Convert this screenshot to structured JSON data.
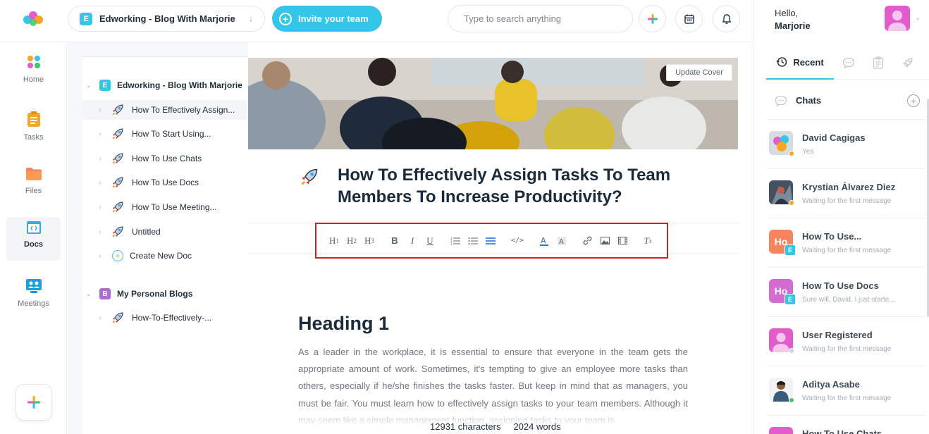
{
  "workspace": {
    "badge": "E",
    "name": "Edworking - Blog With Marjorie",
    "arrow": "↓"
  },
  "invite": {
    "label": "Invite your team"
  },
  "search": {
    "placeholder": "Type to search anything"
  },
  "rail": {
    "items": [
      {
        "label": "Home",
        "icon": "home-icon"
      },
      {
        "label": "Tasks",
        "icon": "tasks-icon"
      },
      {
        "label": "Files",
        "icon": "folder-icon"
      },
      {
        "label": "Docs",
        "icon": "docs-icon",
        "active": true
      },
      {
        "label": "Meetings",
        "icon": "meetings-icon"
      }
    ]
  },
  "tree": {
    "groups": [
      {
        "badge": "E",
        "color": "#35c5e8",
        "name": "Edworking - Blog With Marjorie"
      },
      {
        "badge": "B",
        "color": "#b06ad6",
        "name": "My Personal Blogs"
      }
    ],
    "docs": [
      {
        "label": "How To Effectively Assign..."
      },
      {
        "label": "How To Start Using..."
      },
      {
        "label": "How To Use Chats"
      },
      {
        "label": "How To Use Docs"
      },
      {
        "label": "How To Use Meeting..."
      },
      {
        "label": "Untitled"
      }
    ],
    "create_new": "Create New Doc",
    "personal_docs": [
      {
        "label": "How-To-Effectively-..."
      }
    ]
  },
  "editor": {
    "update_cover": "Update Cover",
    "title": "How To Effectively Assign Tasks To Team Members To Increase Productivity?",
    "toolbar": [
      "H1",
      "H2",
      "H3",
      "B",
      "I",
      "U",
      "ordered-list",
      "bullet-list",
      "align",
      "code",
      "text-color",
      "highlight",
      "link",
      "image",
      "video",
      "clear-format"
    ],
    "heading": "Heading 1",
    "body": "As a leader in the workplace, it is essential to ensure that everyone in the team gets the appropriate amount of work. Sometimes, it's tempting to give an employee more tasks than others, especially if he/she finishes the tasks faster. But keep in mind that as managers, you must be fair. You must learn how to effectively assign tasks to your team members. Although it may seem like a simple management function, assigning tasks to your team is",
    "characters": "12931 characters",
    "words": "2024 words"
  },
  "right": {
    "hello": "Hello,",
    "user": "Marjorie",
    "tab_recent": "Recent",
    "chats_title": "Chats",
    "chats": [
      {
        "name": "David Cagigas",
        "msg": "Yes",
        "status": "#f5a623",
        "avatar": "#b8c4d0"
      },
      {
        "name": "Krystian Álvarez Diez",
        "msg": "Waiting for the first message",
        "status": "#f5a623",
        "avatar": "#5d6b78"
      },
      {
        "name": "How To Use...",
        "msg": "Waiting for the first message",
        "avatar": "#f7845e",
        "initials": "Ho",
        "badge": "E"
      },
      {
        "name": "How To Use Docs",
        "msg": "Sure will, David. I just starte...",
        "avatar": "#d46bd0",
        "initials": "Ho",
        "badge": "E"
      },
      {
        "name": "User Registered",
        "msg": "Waiting for the first message",
        "status": "#d0d4d9",
        "avatar": "#e35ccc"
      },
      {
        "name": "Aditya Asabe",
        "msg": "Waiting for the first message",
        "status": "#3cc86b",
        "avatar": "#f0f2f4"
      },
      {
        "name": "How To Use Chats",
        "msg": "",
        "avatar": "#e35ccc"
      }
    ]
  }
}
